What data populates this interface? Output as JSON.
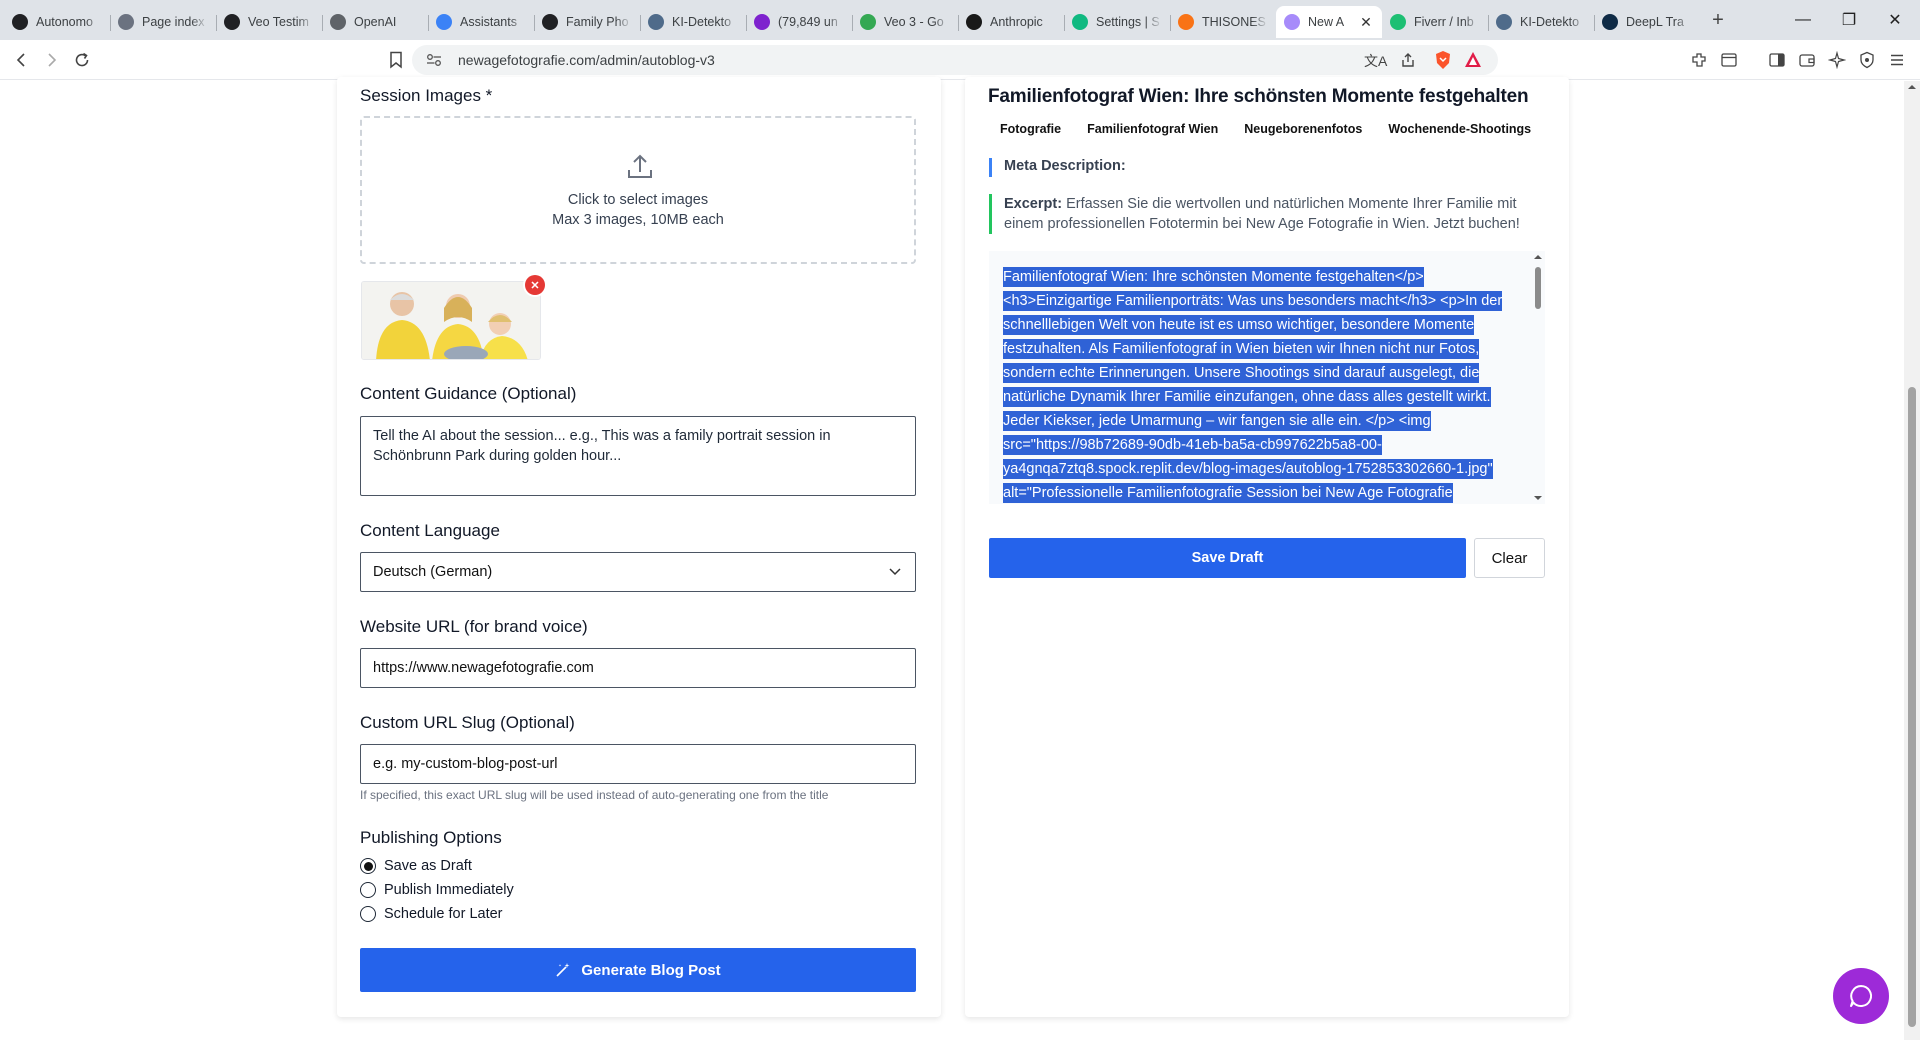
{
  "browser": {
    "tabs": [
      {
        "label": "Autonomo",
        "icon": "openai-icon",
        "color": "#202124"
      },
      {
        "label": "Page index",
        "icon": "page-index-icon",
        "color": "#6b7280"
      },
      {
        "label": "Veo Testim",
        "icon": "openai-icon",
        "color": "#202124"
      },
      {
        "label": "OpenAI",
        "icon": "openai-icon",
        "color": "#5f6368"
      },
      {
        "label": "Assistants",
        "icon": "assistants-icon",
        "color": "#3b82f6"
      },
      {
        "label": "Family Pho",
        "icon": "openai-icon",
        "color": "#202124"
      },
      {
        "label": "KI-Detekto",
        "icon": "ki-detektor-icon",
        "color": "#4f6b8a"
      },
      {
        "label": "(79,849 un",
        "icon": "mail-icon",
        "color": "#7e22ce"
      },
      {
        "label": "Veo 3 - Go",
        "icon": "google-drive-icon",
        "color": "#34a853"
      },
      {
        "label": "Anthropic",
        "icon": "anthropic-icon",
        "color": "#191919"
      },
      {
        "label": "Settings | S",
        "icon": "settings-chart-icon",
        "color": "#10b981"
      },
      {
        "label": "THISONES",
        "icon": "thisones-icon",
        "color": "#f97316"
      },
      {
        "label": "New A",
        "icon": "replit-icon",
        "color": "#a78bfa",
        "active": true
      },
      {
        "label": "Fiverr / Inb",
        "icon": "fiverr-icon",
        "color": "#1dbf73"
      },
      {
        "label": "KI-Detekto",
        "icon": "ki-detektor-icon",
        "color": "#4f6b8a"
      },
      {
        "label": "DeepL Tra",
        "icon": "deepl-icon",
        "color": "#0f2b46"
      }
    ],
    "url": "newagefotografie.com/admin/autoblog-v3"
  },
  "form": {
    "session_images_label": "Session Images *",
    "dropzone_line1": "Click to select images",
    "dropzone_line2": "Max 3 images, 10MB each",
    "guidance_label": "Content Guidance (Optional)",
    "guidance_placeholder": "Tell the AI about the session... e.g., This was a family portrait session in Schönbrunn Park during golden hour...",
    "language_label": "Content Language",
    "language_value": "Deutsch (German)",
    "website_label": "Website URL (for brand voice)",
    "website_value": "https://www.newagefotografie.com",
    "slug_label": "Custom URL Slug (Optional)",
    "slug_placeholder": "e.g. my-custom-blog-post-url",
    "slug_hint": "If specified, this exact URL slug will be used instead of auto-generating one from the title",
    "publishing_label": "Publishing Options",
    "publishing_options": [
      {
        "label": "Save as Draft",
        "selected": true
      },
      {
        "label": "Publish Immediately",
        "selected": false
      },
      {
        "label": "Schedule for Later",
        "selected": false
      }
    ],
    "generate_button": "Generate Blog Post"
  },
  "preview": {
    "title": "Familienfotograf Wien: Ihre schönsten Momente festgehalten",
    "tags": [
      "Fotografie",
      "Familienfotograf Wien",
      "Neugeborenenfotos",
      "Wochenende-Shootings"
    ],
    "meta_label": "Meta Description:",
    "excerpt_label": "Excerpt:",
    "excerpt_text": "Erfassen Sie die wertvollen und natürlichen Momente Ihrer Familie mit einem professionellen Fototermin bei New Age Fotografie in Wien. Jetzt buchen!",
    "content_html": "Familienfotograf Wien: Ihre schönsten Momente festgehalten</p> <h3>Einzigartige Familienporträts: Was uns besonders macht</h3> <p>In der schnelllebigen Welt von heute ist es umso wichtiger, besondere Momente festzuhalten. Als Familienfotograf in Wien bieten wir Ihnen nicht nur Fotos, sondern echte Erinnerungen. Unsere Shootings sind darauf ausgelegt, die natürliche Dynamik Ihrer Familie einzufangen, ohne dass alles gestellt wirkt. Jeder Kiekser, jede Umarmung – wir fangen sie alle ein. </p> <img src=\"https://98b72689-90db-41eb-ba5a-cb997622b5a8-00-ya4gnqa7ztq8.spock.replit.dev/blog-images/autoblog-1752853302660-1.jpg\" alt=\"Professionelle Familienfotografie Session bei New Age Fotografie",
    "save_draft_button": "Save Draft",
    "clear_button": "Clear"
  },
  "colors": {
    "primary": "#2563eb",
    "selection": "#2f62d6",
    "meta_border": "#3b82f6",
    "excerpt_border": "#22c55e",
    "chat_fab": "#9d2ad8"
  }
}
